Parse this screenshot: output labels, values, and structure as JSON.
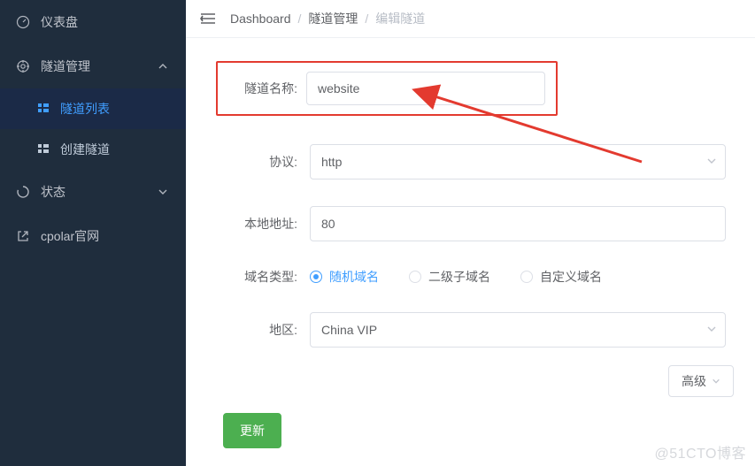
{
  "sidebar": {
    "items": [
      {
        "label": "仪表盘"
      },
      {
        "label": "隧道管理"
      },
      {
        "label": "隧道列表"
      },
      {
        "label": "创建隧道"
      },
      {
        "label": "状态"
      },
      {
        "label": "cpolar官网"
      }
    ]
  },
  "breadcrumb": {
    "a": "Dashboard",
    "b": "隧道管理",
    "c": "编辑隧道",
    "sep": "/"
  },
  "form": {
    "name_label": "隧道名称:",
    "name_value": "website",
    "protocol_label": "协议:",
    "protocol_value": "http",
    "local_label": "本地地址:",
    "local_value": "80",
    "domain_type_label": "域名类型:",
    "domain_options": [
      "随机域名",
      "二级子域名",
      "自定义域名"
    ],
    "region_label": "地区:",
    "region_value": "China VIP",
    "advanced_label": "高级",
    "submit_label": "更新"
  },
  "watermark": "@51CTO博客"
}
